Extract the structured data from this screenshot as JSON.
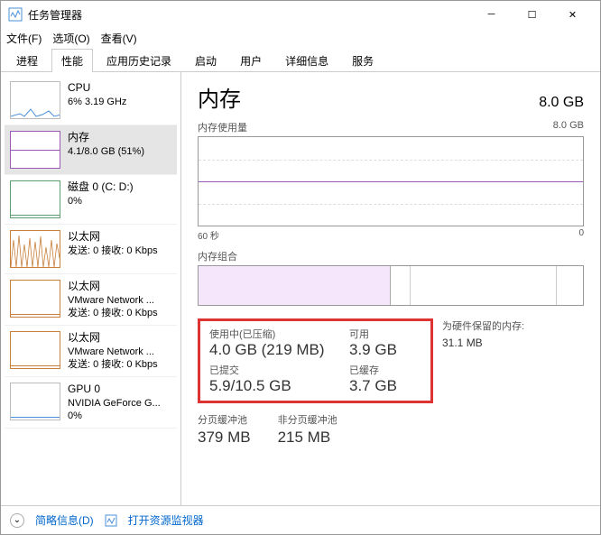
{
  "window": {
    "title": "任务管理器",
    "min": "─",
    "max": "☐",
    "close": "✕"
  },
  "menu": {
    "file": "文件(F)",
    "options": "选项(O)",
    "view": "查看(V)"
  },
  "tabs": {
    "t0": "进程",
    "t1": "性能",
    "t2": "应用历史记录",
    "t3": "启动",
    "t4": "用户",
    "t5": "详细信息",
    "t6": "服务"
  },
  "sidebar": {
    "cpu": {
      "name": "CPU",
      "sub": "6%  3.19 GHz"
    },
    "mem": {
      "name": "内存",
      "sub": "4.1/8.0 GB (51%)"
    },
    "disk": {
      "name": "磁盘 0 (C: D:)",
      "sub": "0%"
    },
    "eth1": {
      "name": "以太网",
      "sub": "发送: 0 接收: 0 Kbps"
    },
    "eth2": {
      "name": "以太网",
      "sub1": "VMware Network ...",
      "sub2": "发送: 0 接收: 0 Kbps"
    },
    "eth3": {
      "name": "以太网",
      "sub1": "VMware Network ...",
      "sub2": "发送: 0 接收: 0 Kbps"
    },
    "gpu": {
      "name": "GPU 0",
      "sub1": "NVIDIA GeForce G...",
      "sub2": "0%"
    }
  },
  "content": {
    "title": "内存",
    "total": "8.0 GB",
    "usage_label": "内存使用量",
    "usage_max": "8.0 GB",
    "axis_left": "60 秒",
    "axis_right": "0",
    "comp_label": "内存组合",
    "stats": {
      "in_use_label": "使用中(已压缩)",
      "in_use_value": "4.0 GB (219 MB)",
      "avail_label": "可用",
      "avail_value": "3.9 GB",
      "commit_label": "已提交",
      "commit_value": "5.9/10.5 GB",
      "cached_label": "已缓存",
      "cached_value": "3.7 GB"
    },
    "reserved_label": "为硬件保留的内存:",
    "reserved_value": "31.1 MB",
    "paged_label": "分页缓冲池",
    "paged_value": "379 MB",
    "nonpaged_label": "非分页缓冲池",
    "nonpaged_value": "215 MB"
  },
  "footer": {
    "brief": "简略信息(D)",
    "resmon": "打开资源监视器"
  },
  "chart_data": {
    "type": "line",
    "title": "内存使用量",
    "xlabel": "60 秒",
    "ylabel": "GB",
    "ylim": [
      0,
      8.0
    ],
    "x": [
      60,
      50,
      40,
      30,
      20,
      10,
      0
    ],
    "values": [
      4.1,
      4.1,
      4.0,
      4.0,
      4.1,
      4.1,
      4.1
    ]
  }
}
